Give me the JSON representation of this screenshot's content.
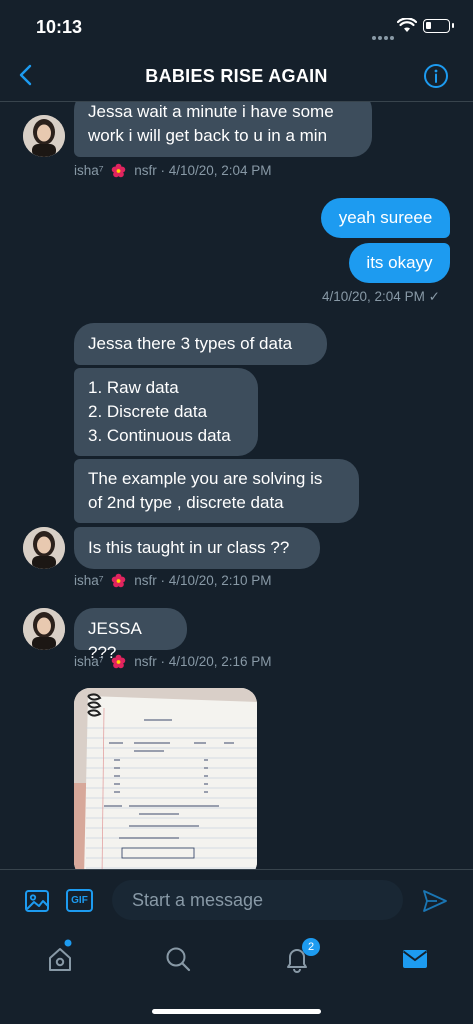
{
  "status_bar": {
    "time": "10:13"
  },
  "header": {
    "title": "BABIES RISE AGAIN"
  },
  "messages": [
    {
      "direction": "in",
      "lines": [
        "Jessa wait a minute i have some",
        "work i will get back to u in a min"
      ]
    },
    {
      "direction": "out",
      "lines": [
        "yeah sureee"
      ]
    },
    {
      "direction": "out",
      "lines": [
        "its okayy"
      ]
    },
    {
      "direction": "in",
      "lines": [
        "Jessa there 3 types of data"
      ]
    },
    {
      "direction": "in",
      "lines": [
        "1. Raw data",
        "2. Discrete data",
        "3. Continuous data"
      ]
    },
    {
      "direction": "in",
      "lines": [
        "The example you are solving is",
        "of 2nd type , discrete data"
      ]
    },
    {
      "direction": "in",
      "lines": [
        "Is this taught in ur class ??"
      ]
    },
    {
      "direction": "in",
      "lines": [
        "JESSA ???"
      ]
    }
  ],
  "meta": {
    "m1": {
      "sender": "isha⁷",
      "name_after": "nsfr",
      "time": "· 4/10/20, 2:04 PM"
    },
    "m2": {
      "time": "4/10/20, 2:04 PM",
      "check": "✓"
    },
    "m3": {
      "sender": "isha⁷",
      "name_after": "nsfr",
      "time": "· 4/10/20, 2:10 PM"
    },
    "m4": {
      "sender": "isha⁷",
      "name_after": "nsfr",
      "time": "· 4/10/20, 2:16 PM"
    }
  },
  "composer": {
    "placeholder": "Start a message",
    "gif_label": "GIF"
  },
  "tabbar": {
    "notifications_badge": "2"
  },
  "colors": {
    "background": "#15202b",
    "incoming_bubble": "#3d4d5c",
    "outgoing_bubble": "#1d9bf0",
    "accent": "#1d9bf0",
    "muted_text": "#8899a6"
  },
  "icons": [
    "back-chevron-icon",
    "info-icon",
    "image-icon",
    "gif-icon",
    "send-icon",
    "home-icon",
    "search-icon",
    "bell-icon",
    "mail-icon",
    "flower-icon"
  ]
}
